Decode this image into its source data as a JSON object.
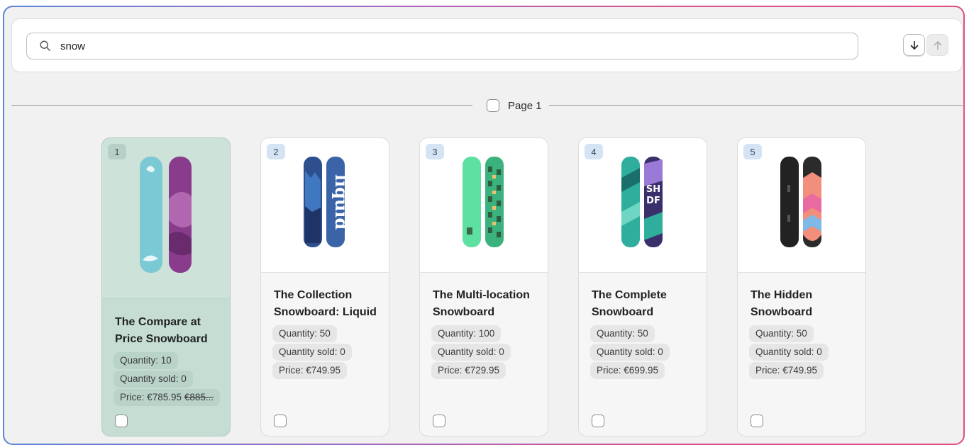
{
  "search": {
    "value": "snow",
    "placeholder": ""
  },
  "sort": {
    "descending_icon": "arrow-down-icon",
    "ascending_icon": "arrow-up-icon"
  },
  "page": {
    "label": "Page 1"
  },
  "products": [
    {
      "index": "1",
      "title": "The Compare at Price Snowboard",
      "quantity": "Quantity: 10",
      "quantity_sold": "Quantity sold: 0",
      "price": "Price: €785.95",
      "compare_price": "€885...",
      "selected": true,
      "colors": [
        "#7cc9d6",
        "#8a3c8c"
      ]
    },
    {
      "index": "2",
      "title": "The Collection Snowboard: Liquid",
      "quantity": "Quantity: 50",
      "quantity_sold": "Quantity sold: 0",
      "price": "Price: €749.95",
      "selected": false,
      "colors": [
        "#2d4f8e",
        "#3b64a8"
      ]
    },
    {
      "index": "3",
      "title": "The Multi-location Snowboard",
      "quantity": "Quantity: 100",
      "quantity_sold": "Quantity sold: 0",
      "price": "Price: €729.95",
      "selected": false,
      "colors": [
        "#5fe0a3",
        "#3bb27d"
      ]
    },
    {
      "index": "4",
      "title": "The Complete Snowboard",
      "quantity": "Quantity: 50",
      "quantity_sold": "Quantity sold: 0",
      "price": "Price: €699.95",
      "selected": false,
      "colors": [
        "#2fae9d",
        "#3a2f6b"
      ]
    },
    {
      "index": "5",
      "title": "The Hidden Snowboard",
      "quantity": "Quantity: 50",
      "quantity_sold": "Quantity sold: 0",
      "price": "Price: €749.95",
      "selected": false,
      "colors": [
        "#222222",
        "#f28f7c"
      ]
    }
  ]
}
